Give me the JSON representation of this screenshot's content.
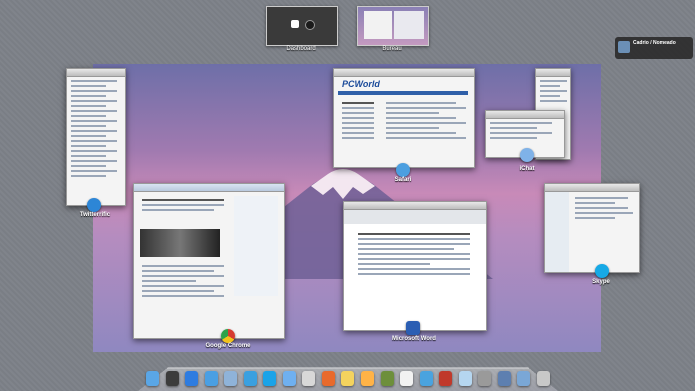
{
  "spaces": [
    {
      "label": "Dashboard"
    },
    {
      "label": "Bureau"
    }
  ],
  "windows": {
    "twitterrific": {
      "label": "Twitterrific"
    },
    "safari": {
      "label": "Safari",
      "logo": "PCWorld"
    },
    "ichat": {
      "label": "iChat"
    },
    "chrome": {
      "label": "Google Chrome"
    },
    "word": {
      "label": "Microsoft Word"
    },
    "skype": {
      "label": "Skype"
    }
  },
  "notification": {
    "title": "Cadrio / Nomeado"
  },
  "colors": {
    "background": "#7d8188",
    "desktop_sky": "#b58cbf",
    "label_text": "#ffffff"
  },
  "dock": {
    "items": [
      "finder-icon",
      "dashboard-icon",
      "app-store-icon",
      "safari-compass-icon",
      "mail-icon",
      "twitterrific-icon",
      "skype-icon",
      "ichat-icon",
      "chrome-icon",
      "firefox-icon",
      "preview-icon",
      "garageband-icon",
      "minecraft-icon",
      "calendar-icon",
      "itunes-icon",
      "photo-booth-icon",
      "iphoto-icon",
      "system-preferences-icon",
      "folder-icon",
      "downloads-icon",
      "trash-icon"
    ]
  }
}
